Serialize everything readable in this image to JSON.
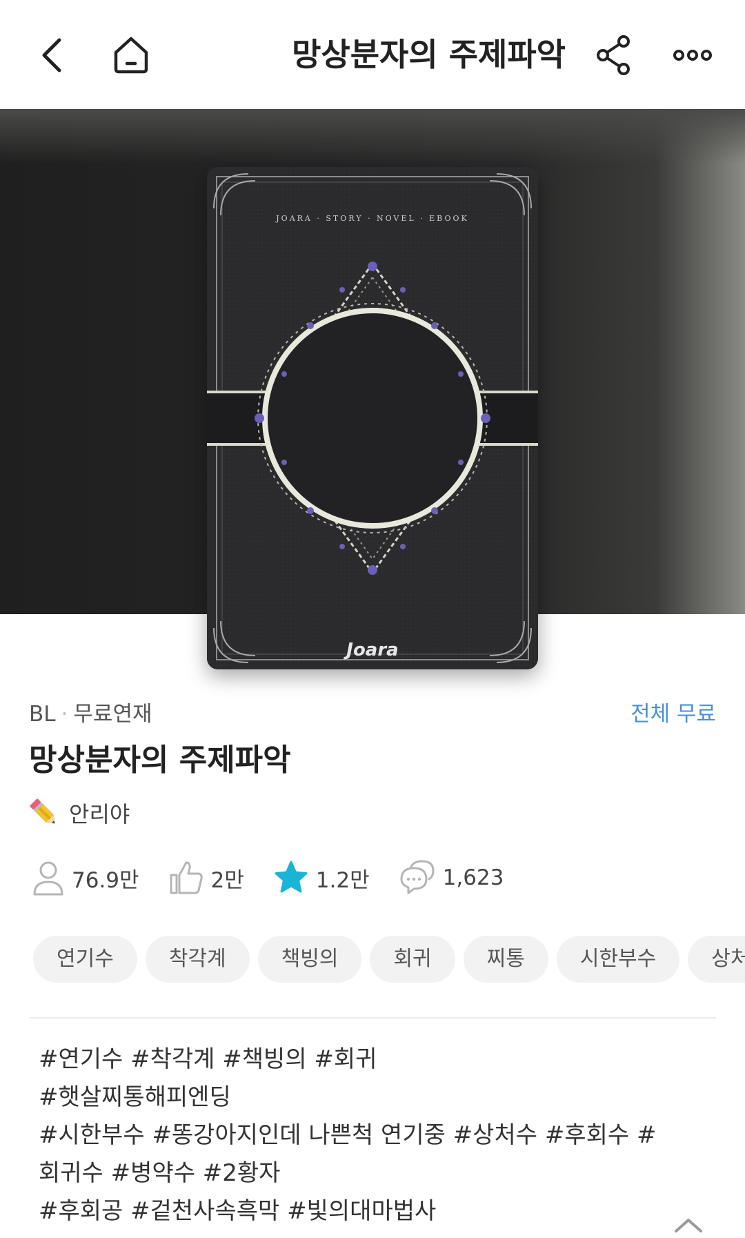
{
  "header": {
    "title": "망상분자의 주제파악",
    "icons": [
      "chevron-left-icon",
      "home-icon",
      "share-icon",
      "more-icon"
    ]
  },
  "cover": {
    "top_text": "JOARA · STORY · NOVEL · EBOOK",
    "publisher_mark": "Joara"
  },
  "meta": {
    "genre": "BL",
    "type": "무료연재",
    "price": "전체 무료"
  },
  "novel": {
    "title": "망상분자의 주제파악",
    "author": "안리야"
  },
  "stats": [
    {
      "icon": "user-icon",
      "value": "76.9만"
    },
    {
      "icon": "thumbs-up-icon",
      "value": "2만"
    },
    {
      "icon": "star-icon",
      "value": "1.2만"
    },
    {
      "icon": "comments-icon",
      "value": "1,623"
    }
  ],
  "tags": [
    "연기수",
    "착각계",
    "책빙의",
    "회귀",
    "찌통",
    "시한부수",
    "상처수"
  ],
  "hashtags": [
    "#연기수 #착각계 #책빙의 #회귀",
    "#햇살찌통해피엔딩",
    "#시한부수 #똥강아지인데 나쁜척 연기중 #상처수 #후회수 #",
    "회귀수 #병약수 #2황자",
    "#후회공 #겉천사속흑막 #빛의대마법사"
  ],
  "colors": {
    "accent_blue": "#4a90d9",
    "star_cyan": "#1ab4d6",
    "chip_bg": "#f2f2f2",
    "hero_bg": "#222222"
  }
}
